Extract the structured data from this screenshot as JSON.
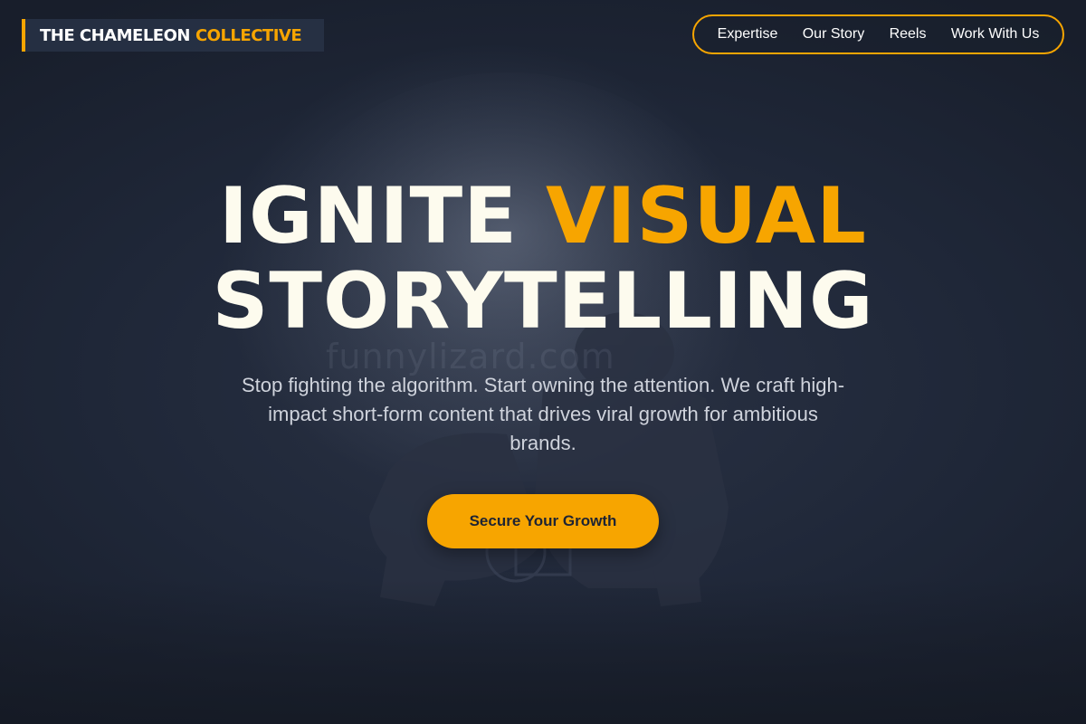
{
  "brand": {
    "name_primary": "THE CHAMELEON",
    "name_accent": "COLLECTIVE"
  },
  "nav": {
    "items": [
      {
        "label": "Expertise"
      },
      {
        "label": "Our Story"
      },
      {
        "label": "Reels"
      },
      {
        "label": "Work With Us"
      }
    ]
  },
  "hero": {
    "title_word1": "IGNITE",
    "title_word2_accent": "VISUAL",
    "title_line2": "STORYTELLING",
    "subtitle": "Stop fighting the algorithm. Start owning the attention. We craft high-impact short-form content that drives viral growth for ambitious brands.",
    "cta_label": "Secure Your Growth"
  },
  "watermark": "funnylizard.com",
  "colors": {
    "accent": "#f7a500",
    "background": "#1c2333",
    "headline": "#fdfbee",
    "body_text": "#cfd3dc"
  }
}
